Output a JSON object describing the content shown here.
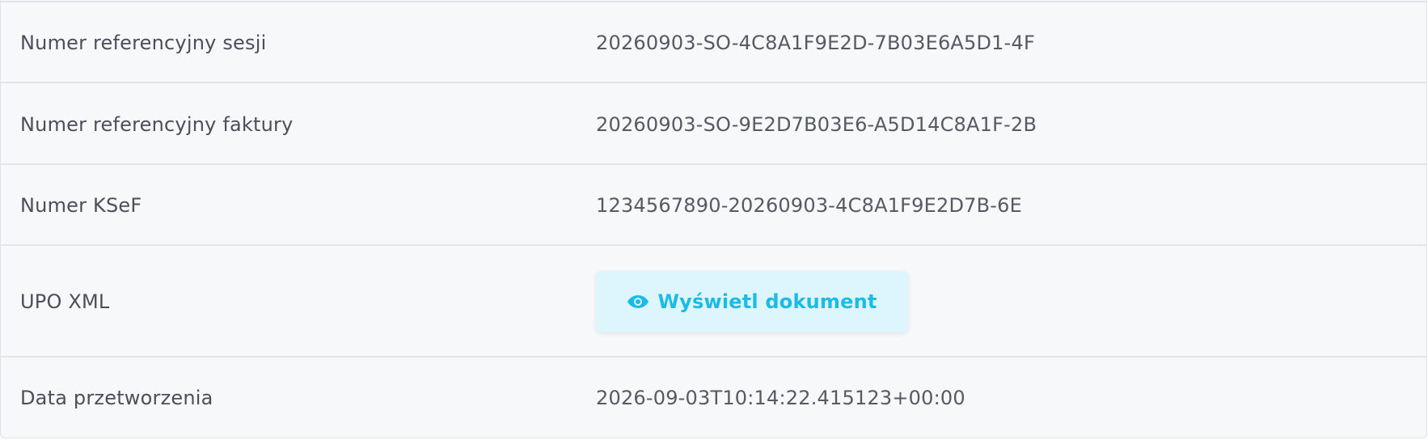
{
  "rows": [
    {
      "label": "Numer referencyjny sesji",
      "value": "20260903-SO-4C8A1F9E2D-7B03E6A5D1-4F"
    },
    {
      "label": "Numer referencyjny faktury",
      "value": "20260903-SO-9E2D7B03E6-A5D14C8A1F-2B"
    },
    {
      "label": "Numer KSeF",
      "value": "1234567890-20260903-4C8A1F9E2D7B-6E"
    },
    {
      "label": "UPO XML",
      "button_label": "Wyświetl dokument",
      "button_icon": "eye-icon"
    },
    {
      "label": "Data przetworzenia",
      "value": "2026-09-03T10:14:22.415123+00:00"
    }
  ],
  "colors": {
    "accent": "#1bbbe8",
    "button_bg": "#ddf5fd",
    "panel_bg": "#f6f8fa",
    "text": "#4a4f5a"
  }
}
